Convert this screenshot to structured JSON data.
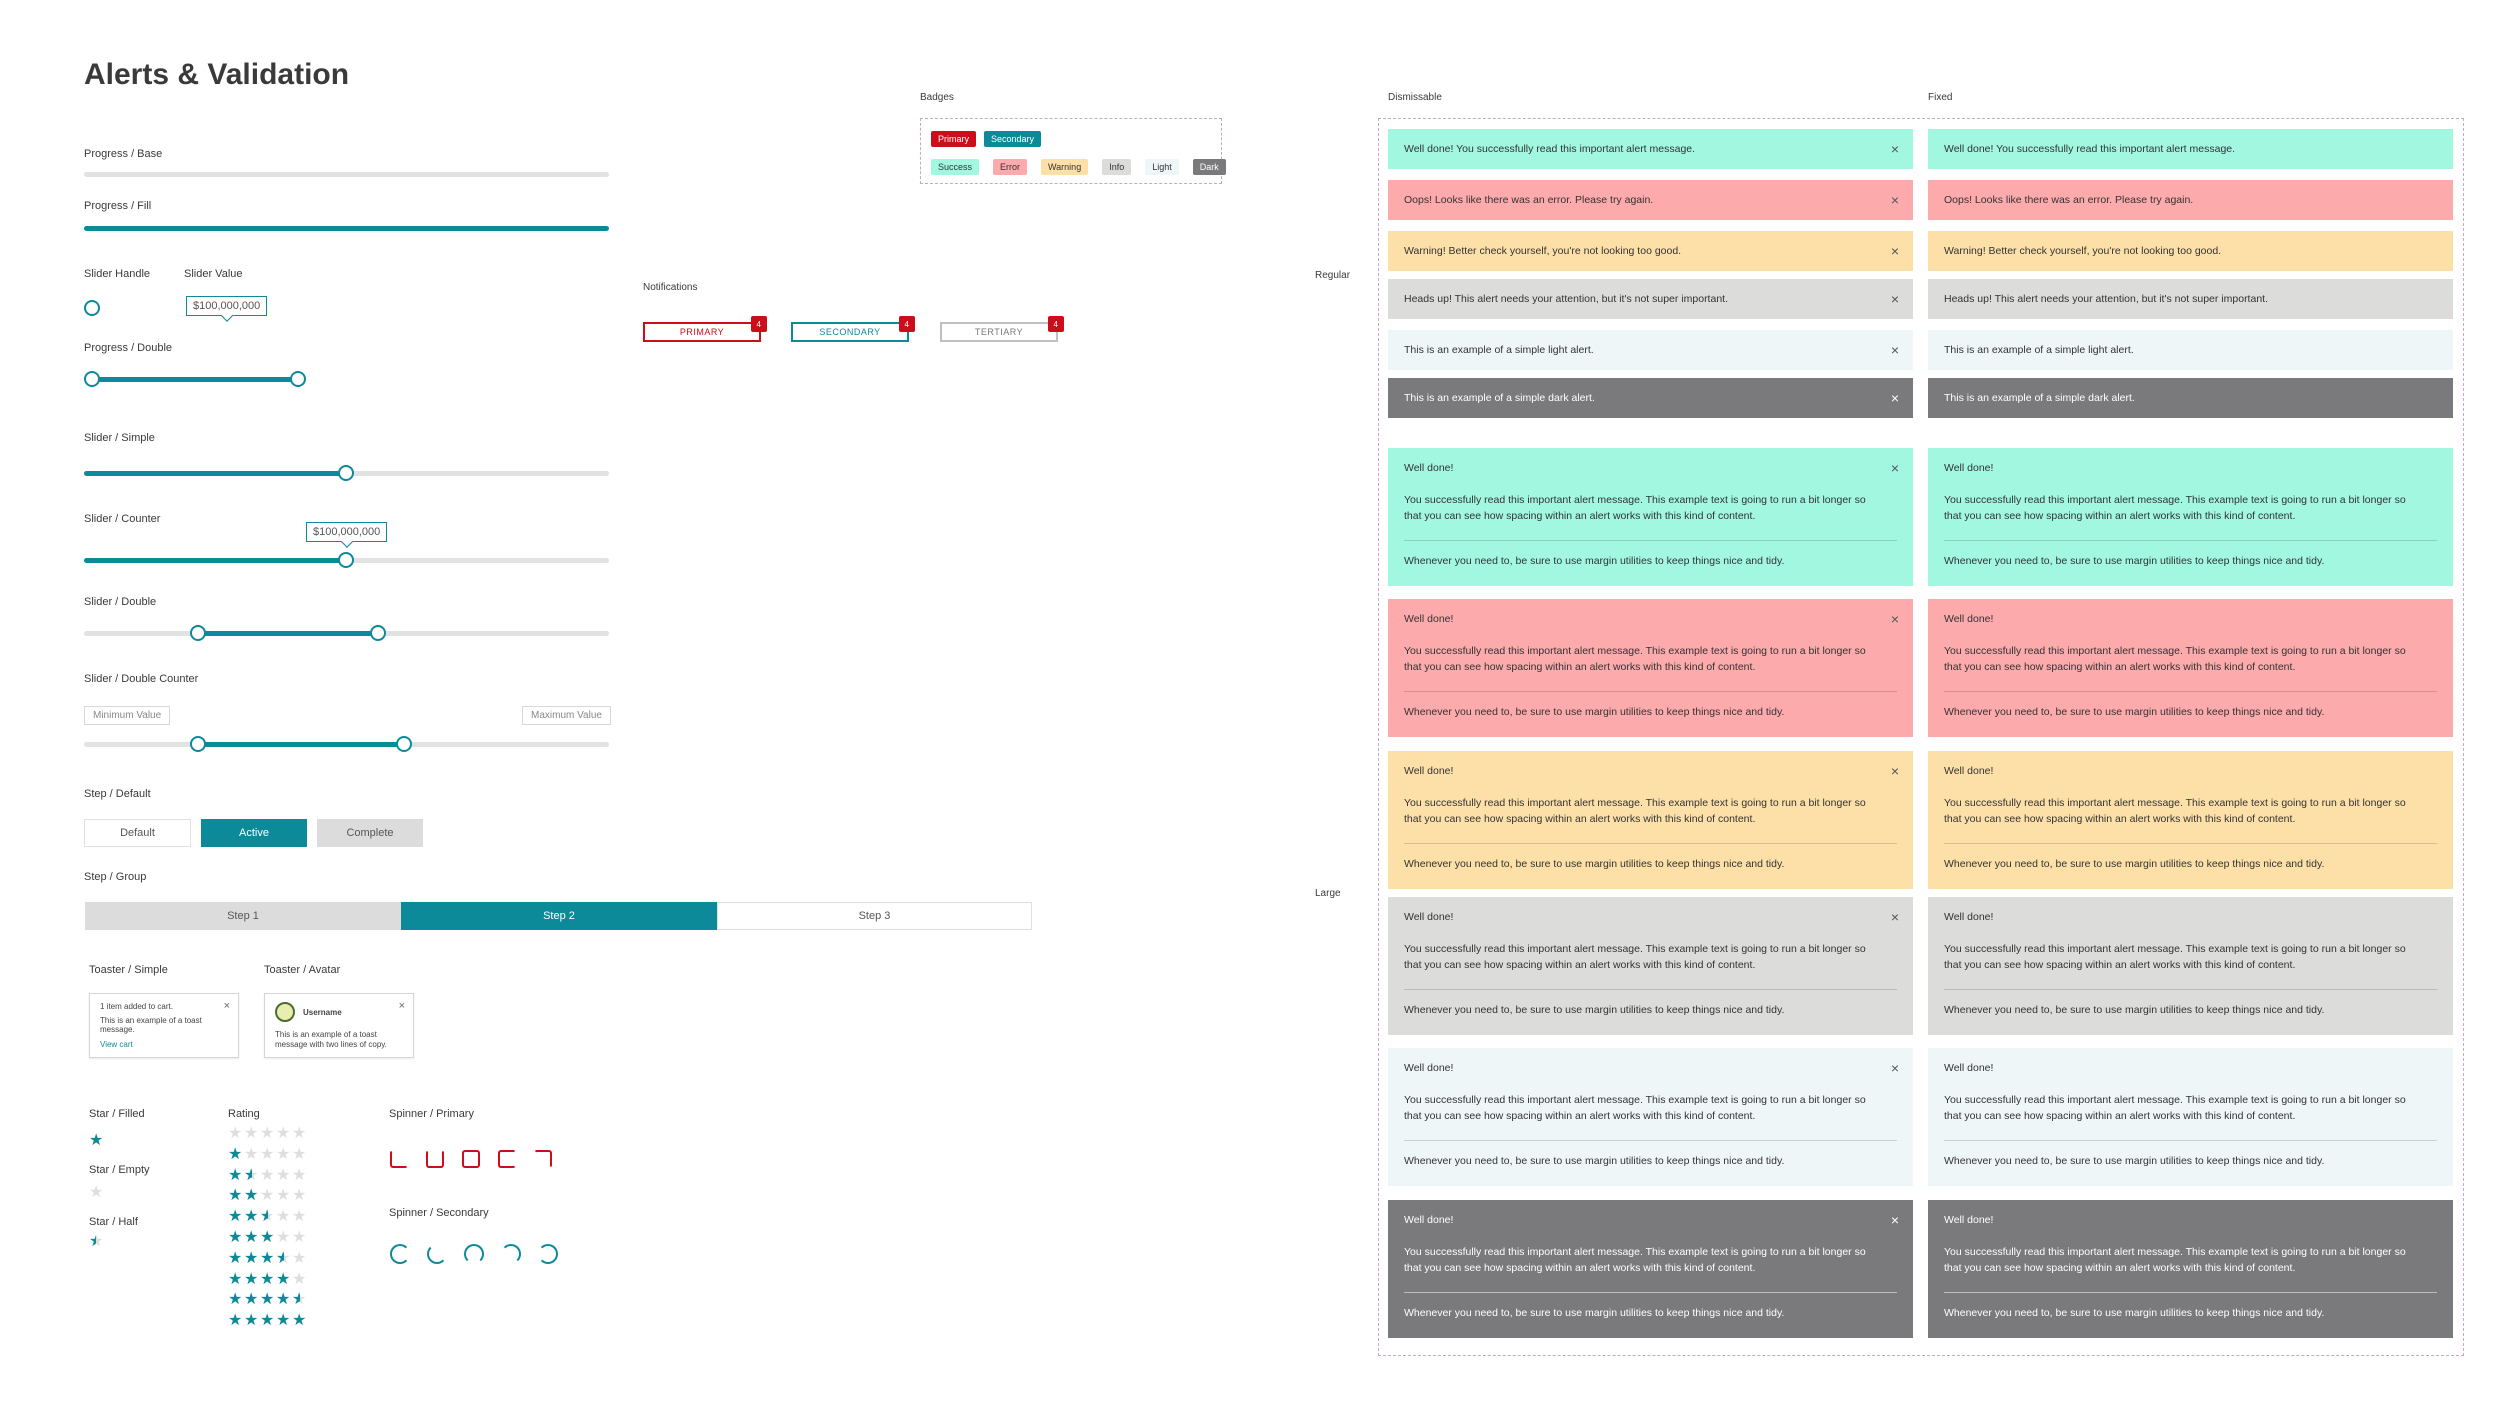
{
  "page": {
    "title": "Alerts & Validation"
  },
  "colors": {
    "teal": "#0d8a9a",
    "red": "#cc0d1a",
    "success": "#a1f7e0",
    "error": "#fcaaac",
    "warning": "#fde0a8",
    "info": "#dcdcda",
    "light": "#eef6f8",
    "dark": "#7a7a7c"
  },
  "progress": {
    "base_label": "Progress / Base",
    "fill_label": "Progress / Fill",
    "fill_value": 1.0
  },
  "slider_handle": {
    "label": "Slider Handle"
  },
  "slider_value": {
    "label": "Slider Value",
    "value": "$100,000,000"
  },
  "progress_double": {
    "label": "Progress / Double",
    "low": 0.0,
    "high": 0.4
  },
  "slider_simple": {
    "label": "Slider / Simple",
    "value": 0.5
  },
  "slider_counter": {
    "label": "Slider / Counter",
    "value": "$100,000,000",
    "level": 0.5
  },
  "slider_double": {
    "label": "Slider / Double",
    "low": 0.22,
    "high": 0.56
  },
  "slider_double_counter": {
    "label": "Slider / Double Counter",
    "min_placeholder": "Minimum Value",
    "max_placeholder": "Maximum Value",
    "low": 0.22,
    "high": 0.62
  },
  "step_default": {
    "label": "Step / Default",
    "items": [
      "Default",
      "Active",
      "Complete"
    ]
  },
  "step_group": {
    "label": "Step / Group",
    "items": [
      "Step 1",
      "Step 2",
      "Step 3"
    ],
    "active_index": 1
  },
  "toaster_simple": {
    "label": "Toaster / Simple",
    "line1": "1 item added to cart.",
    "line2": "This is an example of a toast message.",
    "link": "View cart",
    "close": "×"
  },
  "toaster_avatar": {
    "label": "Toaster / Avatar",
    "username": "Username",
    "text": "This is an example of a toast message with two lines of copy.",
    "close": "×"
  },
  "stars": {
    "filled_label": "Star / Filled",
    "empty_label": "Star / Empty",
    "half_label": "Star / Half",
    "glyph": "★"
  },
  "rating": {
    "label": "Rating",
    "levels": [
      0,
      1,
      1.5,
      2,
      2.5,
      3,
      3.5,
      4,
      4.5,
      5
    ]
  },
  "spinners": {
    "primary_label": "Spinner / Primary",
    "secondary_label": "Spinner / Secondary"
  },
  "badges": {
    "label": "Badges",
    "primary": "Primary",
    "secondary": "Secondary",
    "success": "Success",
    "error": "Error",
    "warning": "Warning",
    "info": "Info",
    "light": "Light",
    "dark": "Dark"
  },
  "notifications": {
    "label": "Notifications",
    "primary": "PRIMARY",
    "secondary": "SECONDARY",
    "tertiary": "TERTIARY",
    "count": "4"
  },
  "alerts": {
    "dismissable_label": "Dismissable",
    "fixed_label": "Fixed",
    "regular_label": "Regular",
    "large_label": "Large",
    "close": "×",
    "regular": [
      "Well done! You successfully read this important alert message.",
      "Oops! Looks like there was an error. Please try again.",
      "Warning! Better check yourself, you're not looking too good.",
      "Heads up! This alert needs your attention, but it's not super important.",
      "This is an example of a simple light alert.",
      "This is an example of a simple dark alert."
    ],
    "large": {
      "heading": "Well done!",
      "body": "You successfully read this important alert message. This example text is going to run a bit longer so that you can see how spacing within an alert works with this kind of content.",
      "footer": "Whenever you need to, be sure to use margin utilities to keep things nice and tidy."
    }
  }
}
